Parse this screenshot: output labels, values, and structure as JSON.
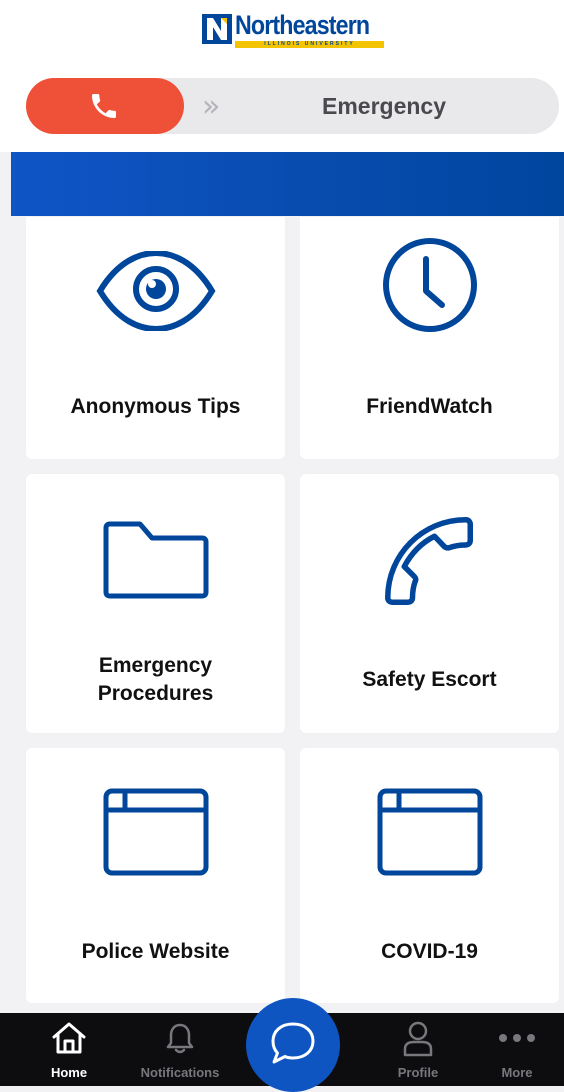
{
  "brand": {
    "logo_text": "Northeastern",
    "logo_subtext": "ILLINOIS UNIVERSITY",
    "primary_color": "#00469b",
    "accent_color": "#f5c400"
  },
  "emergency_bar": {
    "label": "Emergency",
    "call_icon": "phone-icon",
    "chevron_icon": "double-chevron-right-icon",
    "call_color": "#ef5138"
  },
  "tiles": [
    {
      "label": "Anonymous Tips",
      "icon": "eye-icon"
    },
    {
      "label": "FriendWatch",
      "icon": "clock-icon"
    },
    {
      "label": "Emergency Procedures",
      "icon": "folder-icon"
    },
    {
      "label": "Safety Escort",
      "icon": "phone-icon"
    },
    {
      "label": "Police Website",
      "icon": "browser-window-icon"
    },
    {
      "label": "COVID-19",
      "icon": "browser-window-icon"
    }
  ],
  "tabbar": {
    "items": [
      {
        "label": "Home",
        "icon": "home-icon",
        "active": true
      },
      {
        "label": "Notifications",
        "icon": "bell-icon",
        "active": false
      },
      {
        "label": "Profile",
        "icon": "user-icon",
        "active": false
      },
      {
        "label": "More",
        "icon": "more-dots-icon",
        "active": false
      }
    ],
    "center_action_icon": "chat-bubble-icon"
  }
}
